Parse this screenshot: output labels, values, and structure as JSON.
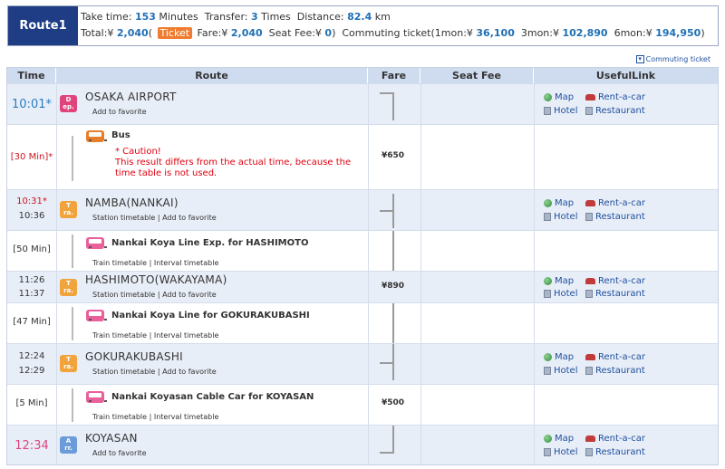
{
  "header": {
    "route_label": "Route1",
    "take_time_label": "Take time:",
    "take_time_value": "153",
    "take_time_unit": "Minutes",
    "transfer_label": "Transfer:",
    "transfer_value": "3",
    "transfer_unit": "Times",
    "distance_label": "Distance:",
    "distance_value": "82.4",
    "distance_unit": "km",
    "total_label": "Total:¥",
    "total_value": "2,040",
    "ticket_button": "Ticket",
    "fare_label": "Fare:¥",
    "fare_value": "2,040",
    "seat_fee_label": "Seat Fee:¥",
    "seat_fee_value": "0",
    "commuting_label": "Commuting ticket(1mon:¥",
    "commuting_1mon": "36,100",
    "commuting_3mon_label": "3mon:¥",
    "commuting_3mon": "102,890",
    "commuting_6mon_label": "6mon:¥",
    "commuting_6mon": "194,950"
  },
  "commuting_ticket_link": "Commuting ticket",
  "columns": {
    "time": "Time",
    "route": "Route",
    "fare": "Fare",
    "seat_fee": "Seat Fee",
    "useful_link": "UsefulLink"
  },
  "useful": {
    "map": "Map",
    "rentacar": "Rent-a-car",
    "hotel": "Hotel",
    "restaurant": "Restaurant"
  },
  "stations": [
    {
      "time": "10:01*",
      "icon_top": "D",
      "icon_bottom": "ep.",
      "name": "OSAKA AIRPORT",
      "links": "Add to favorite"
    },
    {
      "arr": "10:31*",
      "dep": "10:36",
      "icon_top": "T",
      "icon_bottom": "ra.",
      "name": "NAMBA(NANKAI)",
      "links": "Station timetable | Add to favorite"
    },
    {
      "arr": "11:26",
      "dep": "11:37",
      "icon_top": "T",
      "icon_bottom": "ra.",
      "name": "HASHIMOTO(WAKAYAMA)",
      "links": "Station timetable | Add to favorite"
    },
    {
      "arr": "12:24",
      "dep": "12:29",
      "icon_top": "T",
      "icon_bottom": "ra.",
      "name": "GOKURAKUBASHI",
      "links": "Station timetable | Add to favorite"
    },
    {
      "time": "12:34",
      "icon_top": "A",
      "icon_bottom": "rr.",
      "name": "KOYASAN",
      "links": "Add to favorite"
    }
  ],
  "segments": [
    {
      "duration": "[30 Min]*",
      "name": "Bus",
      "caution_title": "* Caution!",
      "caution_text": "This result differs from the actual time, because the time table is not used.",
      "fare": "¥650"
    },
    {
      "duration": "[50 Min]",
      "name": "Nankai Koya Line Exp.  for HASHIMOTO",
      "links": "Train timetable | Interval timetable"
    },
    {
      "duration": "[47 Min]",
      "name": "Nankai Koya Line  for GOKURAKUBASHI",
      "links": "Train timetable | Interval timetable"
    },
    {
      "duration": "[5 Min]",
      "name": "Nankai Koyasan Cable Car  for KOYASAN",
      "links": "Train timetable | Interval timetable"
    }
  ],
  "fares": {
    "hashimoto": "¥890",
    "koyasan": "¥500"
  }
}
